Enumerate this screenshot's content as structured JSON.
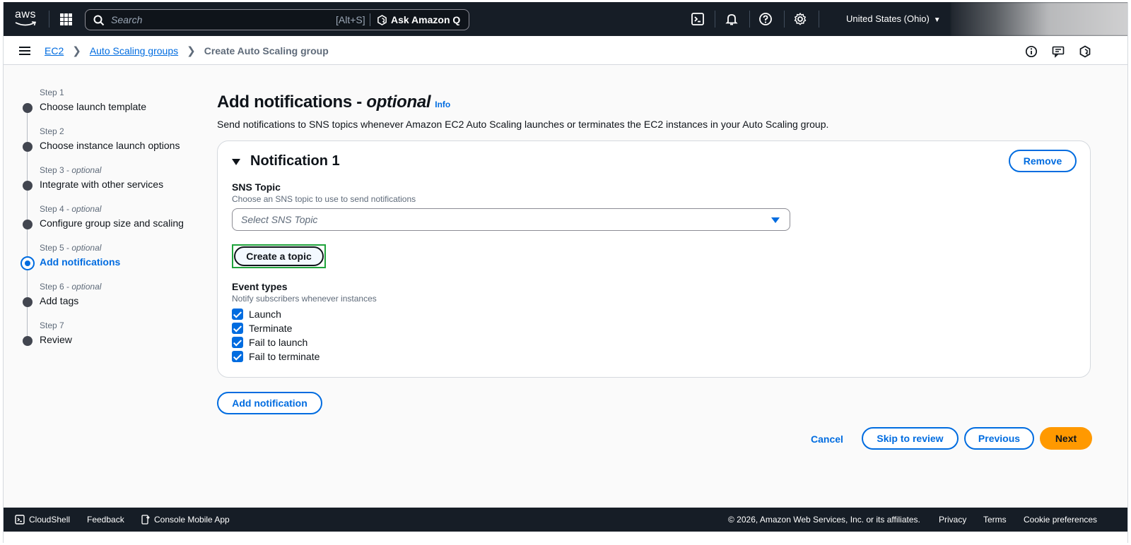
{
  "topnav": {
    "logo_text": "aws",
    "search_placeholder": "Search",
    "search_shortcut": "[Alt+S]",
    "ask_q_label": "Ask Amazon Q",
    "region_label": "United States (Ohio)",
    "icons": [
      "services-grid-icon",
      "search-icon",
      "amazon-q-icon",
      "cloudshell-icon",
      "bell-icon",
      "help-icon",
      "settings-icon",
      "caret-down-icon"
    ]
  },
  "breadcrumb": {
    "items": [
      "EC2",
      "Auto Scaling groups"
    ],
    "current": "Create Auto Scaling group"
  },
  "steps": [
    {
      "step": "Step 1",
      "optional": "",
      "label": "Choose launch template"
    },
    {
      "step": "Step 2",
      "optional": "",
      "label": "Choose instance launch options"
    },
    {
      "step": "Step 3",
      "optional": "optional",
      "label": "Integrate with other services"
    },
    {
      "step": "Step 4",
      "optional": "optional",
      "label": "Configure group size and scaling"
    },
    {
      "step": "Step 5",
      "optional": "optional",
      "label": "Add notifications"
    },
    {
      "step": "Step 6",
      "optional": "optional",
      "label": "Add tags"
    },
    {
      "step": "Step 7",
      "optional": "",
      "label": "Review"
    }
  ],
  "step_separator": " - ",
  "active_step": 4,
  "page": {
    "title": "Add notifications - ",
    "title_optional": "optional",
    "info_link": "Info",
    "description": "Send notifications to SNS topics whenever Amazon EC2 Auto Scaling launches or terminates the EC2 instances in your Auto Scaling group."
  },
  "notification": {
    "title": "Notification 1",
    "remove_label": "Remove",
    "sns_topic_label": "SNS Topic",
    "sns_topic_desc": "Choose an SNS topic to use to send notifications",
    "sns_topic_placeholder": "Select SNS Topic",
    "create_topic_label": "Create a topic",
    "event_types_label": "Event types",
    "event_types_desc": "Notify subscribers whenever instances",
    "events": [
      {
        "label": "Launch",
        "checked": true
      },
      {
        "label": "Terminate",
        "checked": true
      },
      {
        "label": "Fail to launch",
        "checked": true
      },
      {
        "label": "Fail to terminate",
        "checked": true
      }
    ]
  },
  "actions": {
    "add_notification": "Add notification",
    "cancel": "Cancel",
    "skip_to_review": "Skip to review",
    "previous": "Previous",
    "next": "Next"
  },
  "footer": {
    "cloudshell": "CloudShell",
    "feedback": "Feedback",
    "mobile_app": "Console Mobile App",
    "copyright": "© 2026, Amazon Web Services, Inc. or its affiliates.",
    "privacy": "Privacy",
    "terms": "Terms",
    "cookie": "Cookie preferences"
  },
  "colors": {
    "nav_bg": "#161d26",
    "link_blue": "#006ce0",
    "primary_orange": "#ff9900",
    "focus_green": "#1fa33b"
  }
}
